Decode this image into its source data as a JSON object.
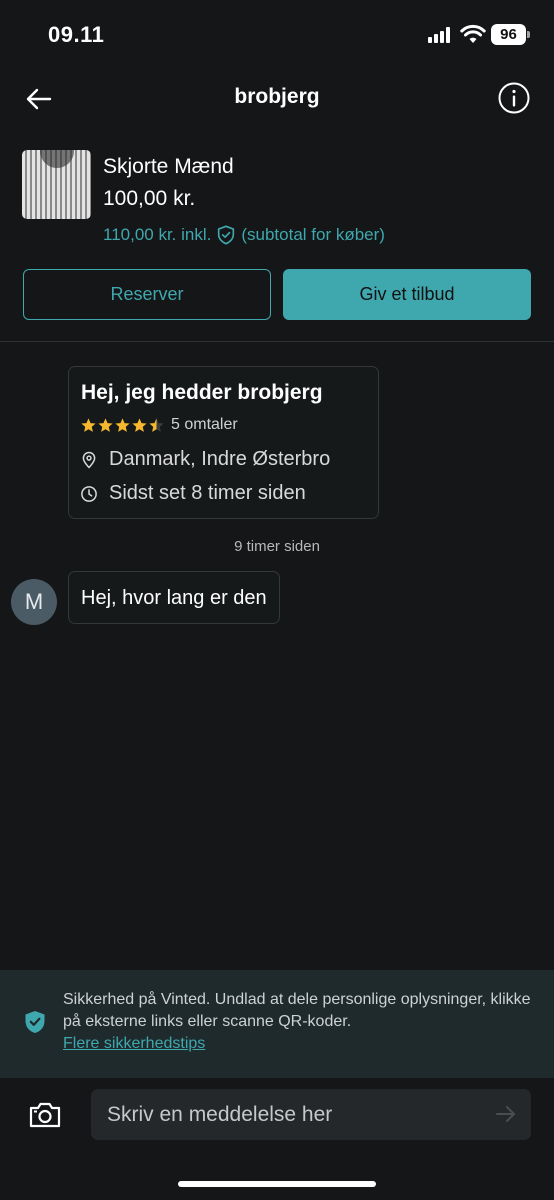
{
  "status_bar": {
    "time": "09.11",
    "battery": "96"
  },
  "header": {
    "title": "brobjerg",
    "back_icon": "arrow-left-icon",
    "info_icon": "info-icon"
  },
  "item": {
    "title": "Skjorte Mænd",
    "price": "100,00 kr.",
    "incl_price": "110,00 kr. inkl.",
    "incl_note": "(subtotal for køber)",
    "shield_icon": "shield-check-icon"
  },
  "actions": {
    "reserve_label": "Reserver",
    "offer_label": "Giv et tilbud"
  },
  "intro": {
    "title": "Hej, jeg hedder brobjerg",
    "rating": 4.5,
    "reviews": "5 omtaler",
    "location": "Danmark, Indre Østerbro",
    "last_seen": "Sidst set 8 timer siden"
  },
  "conversation": {
    "timestamp": "9 timer siden",
    "messages": [
      {
        "avatar_initial": "M",
        "text": "Hej, hvor lang er den"
      }
    ]
  },
  "safety": {
    "text": "Sikkerhed på Vinted. Undlad at dele personlige oplysninger, klikke på eksterne links eller scanne QR-koder.",
    "link": "Flere sikkerhedstips"
  },
  "composer": {
    "placeholder": "Skriv en meddelelse her"
  },
  "colors": {
    "accent": "#3fa8ae",
    "background": "#141617",
    "star": "#f5b82e"
  }
}
